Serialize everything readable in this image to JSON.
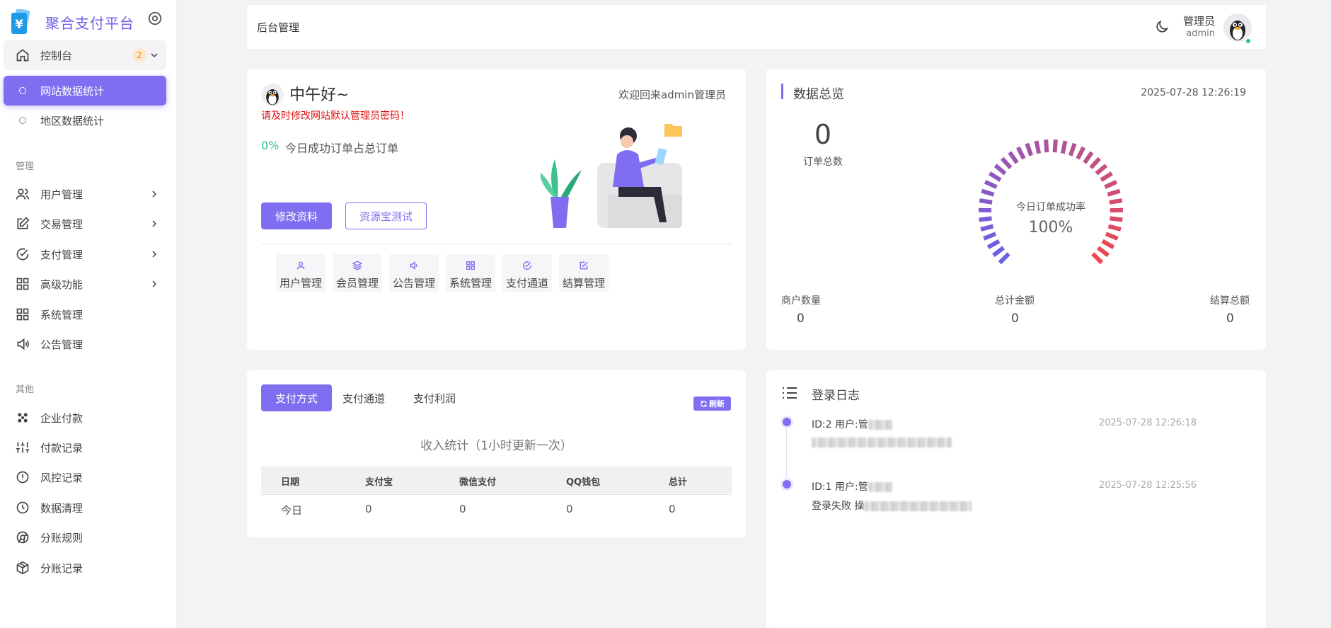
{
  "brand": {
    "name": "聚合支付平台",
    "accent": "#7f6ff0"
  },
  "sidebar": {
    "console": {
      "label": "控制台",
      "badge": "2"
    },
    "sub_items": [
      {
        "label": "网站数据统计",
        "active": true
      },
      {
        "label": "地区数据统计",
        "active": false
      }
    ],
    "section_manage": "管理",
    "manage_items": [
      {
        "label": "用户管理",
        "icon": "users-icon",
        "has_arrow": true
      },
      {
        "label": "交易管理",
        "icon": "edit-icon",
        "has_arrow": true
      },
      {
        "label": "支付管理",
        "icon": "check-circle-icon",
        "has_arrow": true
      },
      {
        "label": "高级功能",
        "icon": "grid-icon",
        "has_arrow": true
      },
      {
        "label": "系统管理",
        "icon": "grid-icon",
        "has_arrow": false
      },
      {
        "label": "公告管理",
        "icon": "speaker-icon",
        "has_arrow": false
      }
    ],
    "section_other": "其他",
    "other_items": [
      {
        "label": "企业付款",
        "icon": "cluster-icon"
      },
      {
        "label": "付款记录",
        "icon": "sliders-icon"
      },
      {
        "label": "风控记录",
        "icon": "alert-circle-icon"
      },
      {
        "label": "数据清理",
        "icon": "clock-icon"
      },
      {
        "label": "分账规则",
        "icon": "chrome-icon"
      },
      {
        "label": "分账记录",
        "icon": "codesandbox-icon"
      }
    ]
  },
  "topbar": {
    "title": "后台管理",
    "user_name": "管理员",
    "user_role": "admin"
  },
  "welcome": {
    "greeting": "中午好~",
    "welcome_back": "欢迎回来admin管理员",
    "warning": "请及时修改网站默认管理员密码！",
    "percent": "0%",
    "percent_label": "今日成功订单占总订单",
    "btn_edit": "修改资料",
    "btn_test": "资源宝测试",
    "quick_links": [
      {
        "label": "用户管理",
        "icon": "user-icon"
      },
      {
        "label": "会员管理",
        "icon": "layers-icon"
      },
      {
        "label": "公告管理",
        "icon": "speaker-icon"
      },
      {
        "label": "系统管理",
        "icon": "grid-icon"
      },
      {
        "label": "支付通道",
        "icon": "check-circle-icon"
      },
      {
        "label": "结算管理",
        "icon": "check-square-icon"
      }
    ]
  },
  "overview": {
    "title": "数据总览",
    "datetime": "2025-07-28 12:26:19",
    "orders_total": "0",
    "orders_total_label": "订单总数",
    "gauge_label": "今日订单成功率",
    "gauge_value": "100%",
    "gauge_fraction": 1.0,
    "stats": [
      {
        "label": "商户数量",
        "value": "0"
      },
      {
        "label": "总计金额",
        "value": "0"
      },
      {
        "label": "结算总额",
        "value": "0"
      }
    ]
  },
  "income": {
    "tabs": [
      "支付方式",
      "支付通道",
      "支付利润"
    ],
    "active_tab": 0,
    "refresh_label": "刷新",
    "title": "收入统计（1小时更新一次）",
    "columns": [
      "日期",
      "支付宝",
      "微信支付",
      "QQ钱包",
      "总计"
    ],
    "rows": [
      [
        "今日",
        "0",
        "0",
        "0",
        "0"
      ]
    ]
  },
  "login_log": {
    "title": "登录日志",
    "entries": [
      {
        "id": "ID:2 用户:管",
        "time": "2025-07-28 12:26:18",
        "desc": ""
      },
      {
        "id": "ID:1 用户:管",
        "time": "2025-07-28 12:25:56",
        "desc": "登录失败 操"
      }
    ]
  }
}
